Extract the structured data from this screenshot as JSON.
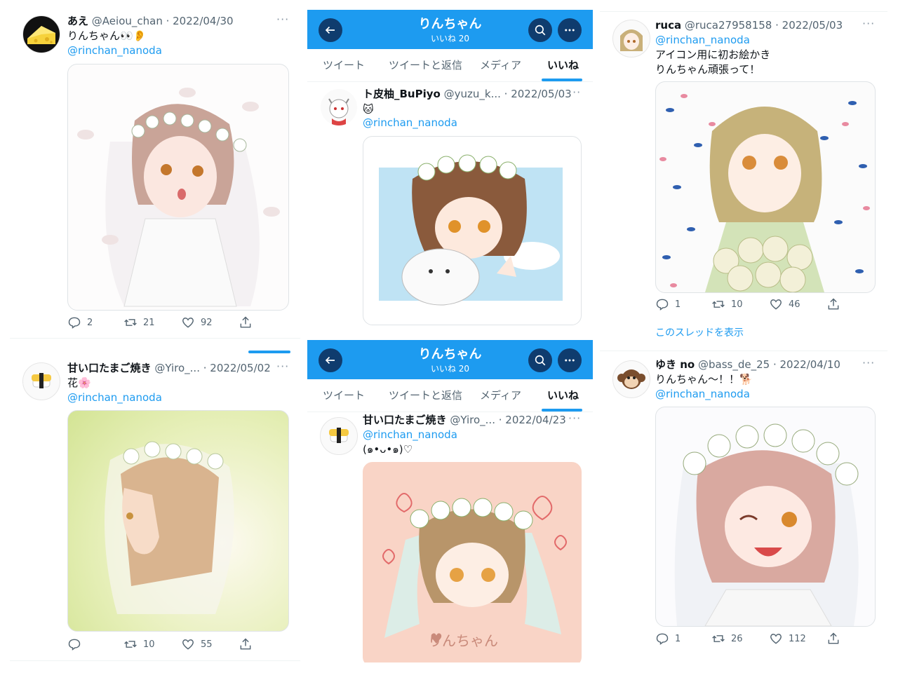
{
  "tabs": [
    "ツイート",
    "ツイートと返信",
    "メディア",
    "いいね"
  ],
  "profile": {
    "title": "りんちゃん",
    "subtitle": "いいね 20"
  },
  "more_label": "···",
  "thread_label": "このスレッドを表示",
  "colors": {
    "accent": "#1d9bf0",
    "text": "#0f1419",
    "muted": "#536471",
    "topbar_button": "#0f3c6e"
  },
  "tweets": [
    {
      "name": "あえ",
      "handle": "@Aeiou_chan",
      "date": "2022/04/30",
      "text": "りんちゃん👀👂",
      "mention": "@rinchan_nanoda",
      "replies": "2",
      "retweets": "21",
      "likes": "92",
      "avatar_icon": "cheese-icon"
    },
    {
      "name": "ト皮柚_BuPiyo",
      "handle": "@yuzu_k...",
      "date": "2022/05/03",
      "text": "🐱",
      "mention": "@rinchan_nanoda",
      "avatar_icon": "white-cat-avatar-icon"
    },
    {
      "name": "ruca",
      "handle": "@ruca27958158",
      "date": "2022/05/03",
      "mention": "@rinchan_nanoda",
      "text1": "アイコン用に初お絵かき",
      "text2": "りんちゃん頑張って！",
      "replies": "1",
      "retweets": "10",
      "likes": "46",
      "avatar_icon": "girl-avatar-icon"
    },
    {
      "name": "甘い口たまご焼き",
      "handle": "@Yiro_...",
      "date": "2022/05/02",
      "text": "花🌸",
      "mention": "@rinchan_nanoda",
      "replies": "",
      "retweets": "10",
      "likes": "55",
      "avatar_icon": "sushi-icon"
    },
    {
      "name": "甘い口たまご焼き",
      "handle": "@Yiro_...",
      "date": "2022/04/23",
      "mention": "@rinchan_nanoda",
      "text": "(๑•ᴗ•๑)♡",
      "avatar_icon": "sushi-icon"
    },
    {
      "name": "ゆき no",
      "handle": "@bass_de_25",
      "date": "2022/04/10",
      "text": "りんちゃん〜！！🐕",
      "mention": "@rinchan_nanoda",
      "replies": "1",
      "retweets": "26",
      "likes": "112",
      "avatar_icon": "monkey-icon"
    }
  ],
  "images": [
    {
      "name": "bride-girl-drawing",
      "signature": ""
    },
    {
      "name": "chibi-girl-with-cat-drawing"
    },
    {
      "name": "girl-with-bouquet-drawing"
    },
    {
      "name": "profile-girl-veil-drawing"
    },
    {
      "name": "chibi-girl-hearts-drawing",
      "signature": "りんちゃん"
    },
    {
      "name": "winking-girl-drawing"
    }
  ]
}
